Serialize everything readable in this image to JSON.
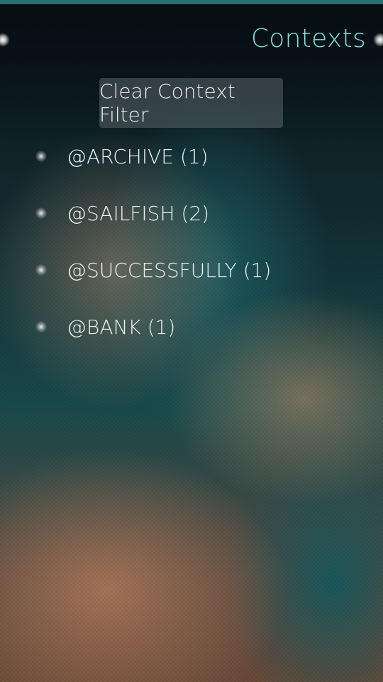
{
  "header": {
    "title": "Contexts"
  },
  "actions": {
    "clear_filter_label": "Clear Context Filter"
  },
  "contexts": {
    "items": [
      {
        "label": "@ARCHIVE (1)"
      },
      {
        "label": "@SAILFISH (2)"
      },
      {
        "label": "@SUCCESSFULLY (1)"
      },
      {
        "label": "@BANK (1)"
      }
    ]
  },
  "colors": {
    "title": "#7ee0e0",
    "top_bar": "#2a6e72",
    "text": "#eef2f2"
  }
}
